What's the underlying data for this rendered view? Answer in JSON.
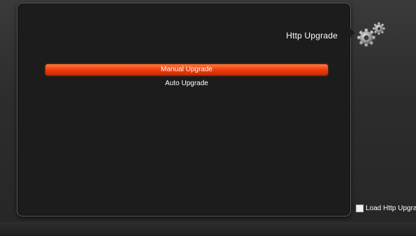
{
  "header": {
    "title": "Http Upgrade",
    "icon": "gears-icon"
  },
  "menu": {
    "items": [
      {
        "label": "Manual Upgrade",
        "selected": true
      },
      {
        "label": "Auto Upgrade",
        "selected": false
      }
    ]
  },
  "footer": {
    "legend_label": "Load Http Upgra",
    "legend_color": "#f0f0f0"
  },
  "colors": {
    "accent": "#f04010",
    "panel": "#1c1c1c",
    "text": "#ffffff"
  }
}
